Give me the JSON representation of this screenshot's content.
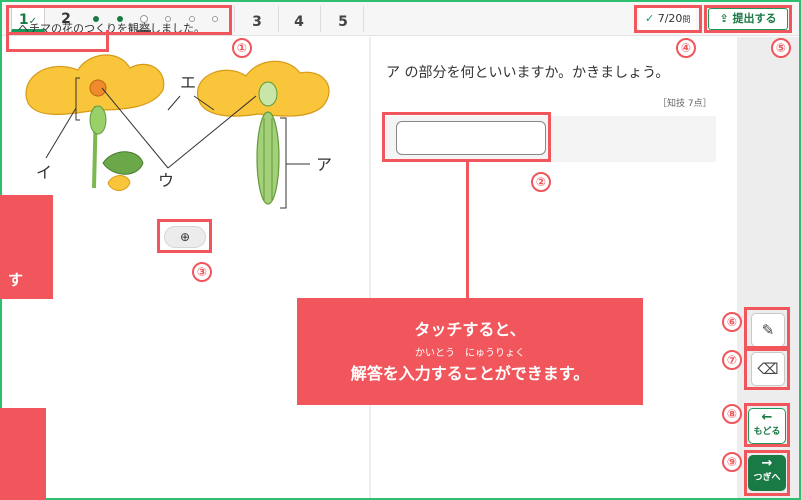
{
  "topbar": {
    "tabs": [
      {
        "label": "1",
        "check": "✓"
      },
      {
        "label": "2"
      },
      {
        "label": "3"
      },
      {
        "label": "4"
      },
      {
        "label": "5"
      }
    ],
    "progress": {
      "answered": 7,
      "total": 20,
      "text": "7/20",
      "unit": "問",
      "check": "✓"
    },
    "submit_label": "提出する",
    "submit_icon": "upload-icon"
  },
  "question": {
    "text": "ヘチマの花のつくりを観察しました。",
    "figure_labels": {
      "a": "ア",
      "i": "イ",
      "u": "ウ",
      "e": "エ"
    },
    "zoom_icon": "zoom-in-icon"
  },
  "answer": {
    "prompt": "ア の部分を何といいますか。かきましょう。",
    "points": "［知技 7点］",
    "input_value": "",
    "input_placeholder": ""
  },
  "tools": {
    "pen_icon": "pencil-icon",
    "eraser_icon": "eraser-icon",
    "back_label": "もどる",
    "back_icon": "arrow-left-icon",
    "next_label": "つぎへ",
    "next_icon": "arrow-right-icon"
  },
  "annotations": {
    "markers": [
      "①",
      "②",
      "③",
      "④",
      "⑤",
      "⑥",
      "⑦",
      "⑧",
      "⑨"
    ],
    "callout_line1": "タッチすると、",
    "callout_ruby": "かいとう　にゅうりょく",
    "callout_line2": "解答を入力することができます。",
    "side_label": "す"
  },
  "colors": {
    "accent": "#1a7a46",
    "annotation": "#f0565b",
    "flower": "#f9c53a",
    "stem": "#7ab850"
  }
}
